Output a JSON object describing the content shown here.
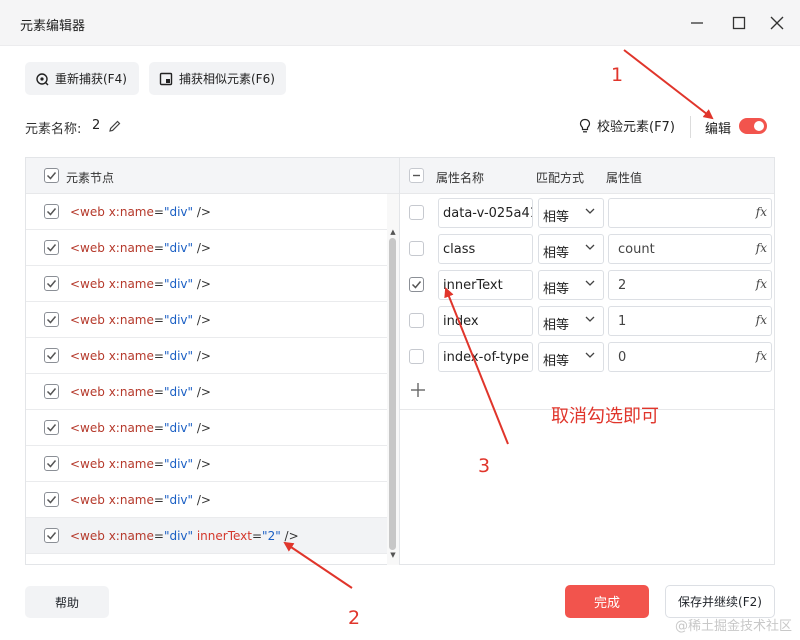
{
  "window": {
    "title": "元素编辑器",
    "controls": [
      "minimize-icon",
      "maximize-icon",
      "close-icon"
    ]
  },
  "toolbar": {
    "recapture_label": "重新捕获(F4)",
    "capture_similar_label": "捕获相似元素(F6)"
  },
  "element": {
    "name_label": "元素名称:",
    "name_value": "2",
    "validate_label": "校验元素(F7)",
    "edit_label": "编辑",
    "edit_enabled": true
  },
  "nodes": {
    "header": "元素节点",
    "rows": [
      {
        "tag": "<web ",
        "attr": "x:name",
        "eq": "=",
        "val": "\"div\"",
        "extra_attr": "",
        "extra_eq": "",
        "extra_val": "",
        "end": " />",
        "checked": true
      },
      {
        "tag": "<web ",
        "attr": "x:name",
        "eq": "=",
        "val": "\"div\"",
        "extra_attr": "",
        "extra_eq": "",
        "extra_val": "",
        "end": " />",
        "checked": true
      },
      {
        "tag": "<web ",
        "attr": "x:name",
        "eq": "=",
        "val": "\"div\"",
        "extra_attr": "",
        "extra_eq": "",
        "extra_val": "",
        "end": " />",
        "checked": true
      },
      {
        "tag": "<web ",
        "attr": "x:name",
        "eq": "=",
        "val": "\"div\"",
        "extra_attr": "",
        "extra_eq": "",
        "extra_val": "",
        "end": " />",
        "checked": true
      },
      {
        "tag": "<web ",
        "attr": "x:name",
        "eq": "=",
        "val": "\"div\"",
        "extra_attr": "",
        "extra_eq": "",
        "extra_val": "",
        "end": " />",
        "checked": true
      },
      {
        "tag": "<web ",
        "attr": "x:name",
        "eq": "=",
        "val": "\"div\"",
        "extra_attr": "",
        "extra_eq": "",
        "extra_val": "",
        "end": " />",
        "checked": true
      },
      {
        "tag": "<web ",
        "attr": "x:name",
        "eq": "=",
        "val": "\"div\"",
        "extra_attr": "",
        "extra_eq": "",
        "extra_val": "",
        "end": " />",
        "checked": true
      },
      {
        "tag": "<web ",
        "attr": "x:name",
        "eq": "=",
        "val": "\"div\"",
        "extra_attr": "",
        "extra_eq": "",
        "extra_val": "",
        "end": " />",
        "checked": true
      },
      {
        "tag": "<web ",
        "attr": "x:name",
        "eq": "=",
        "val": "\"div\"",
        "extra_attr": "",
        "extra_eq": "",
        "extra_val": "",
        "end": " />",
        "checked": true
      },
      {
        "tag": "<web ",
        "attr": "x:name",
        "eq": "=",
        "val": "\"div\"",
        "extra_attr": " innerText",
        "extra_eq": "=",
        "extra_val": "\"2\"",
        "end": " />",
        "checked": true,
        "selected": true
      }
    ]
  },
  "properties": {
    "col_name": "属性名称",
    "col_match": "匹配方式",
    "col_value": "属性值",
    "rows": [
      {
        "name": "data-v-025a41",
        "match": "相等",
        "value": "",
        "checked": false
      },
      {
        "name": "class",
        "match": "相等",
        "value": "count",
        "checked": false
      },
      {
        "name": "innerText",
        "match": "相等",
        "value": "2",
        "checked": true
      },
      {
        "name": "index",
        "match": "相等",
        "value": "1",
        "checked": false
      },
      {
        "name": "index-of-type",
        "match": "相等",
        "value": "0",
        "checked": false
      }
    ],
    "fx_label": "fx"
  },
  "footer": {
    "help_label": "帮助",
    "done_label": "完成",
    "save_continue_label": "保存并继续(F2)"
  },
  "annotations": {
    "num1": "1",
    "num2": "2",
    "num3": "3",
    "note": "取消勾选即可",
    "color": "#e0352b"
  },
  "watermark": "@稀土掘金技术社区",
  "colors": {
    "accent": "#f2544d",
    "tag": "#b5392b",
    "string": "#1a5fc4"
  }
}
